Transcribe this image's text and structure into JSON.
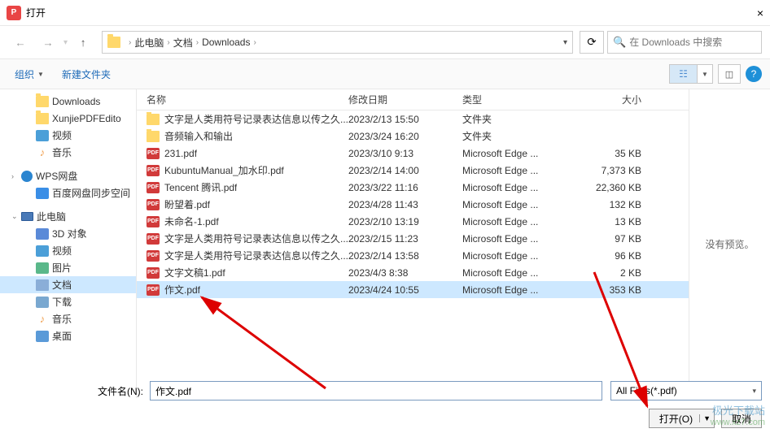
{
  "window": {
    "title": "打开",
    "close": "×"
  },
  "nav": {
    "crumbs": [
      "此电脑",
      "文档",
      "Downloads"
    ],
    "refresh": "↻",
    "search_placeholder": "在 Downloads 中搜索"
  },
  "toolbar": {
    "organize": "组织",
    "new_folder": "新建文件夹",
    "help": "?"
  },
  "sidebar": {
    "items": [
      {
        "label": "Downloads",
        "icon": "folder",
        "indent": 32
      },
      {
        "label": "XunjiePDFEdito",
        "icon": "folder",
        "indent": 32
      },
      {
        "label": "视频",
        "icon": "video",
        "indent": 32
      },
      {
        "label": "音乐",
        "icon": "music",
        "indent": 32
      },
      {
        "label": "WPS网盘",
        "icon": "wps",
        "indent": 14,
        "exp": "›"
      },
      {
        "label": "百度网盘同步空间",
        "icon": "baidu",
        "indent": 32
      },
      {
        "label": "此电脑",
        "icon": "pc",
        "indent": 14,
        "exp": "⌄"
      },
      {
        "label": "3D 对象",
        "icon": "3d",
        "indent": 32
      },
      {
        "label": "视频",
        "icon": "video",
        "indent": 32
      },
      {
        "label": "图片",
        "icon": "pic",
        "indent": 32
      },
      {
        "label": "文档",
        "icon": "doc",
        "indent": 32,
        "selected": true
      },
      {
        "label": "下载",
        "icon": "down",
        "indent": 32
      },
      {
        "label": "音乐",
        "icon": "music",
        "indent": 32
      },
      {
        "label": "桌面",
        "icon": "desk",
        "indent": 32
      }
    ]
  },
  "files": {
    "headers": {
      "name": "名称",
      "date": "修改日期",
      "type": "类型",
      "size": "大小"
    },
    "rows": [
      {
        "icon": "folder",
        "name": "文字是人类用符号记录表达信息以传之久...",
        "date": "2023/2/13 15:50",
        "type": "文件夹",
        "size": ""
      },
      {
        "icon": "folder",
        "name": "音频输入和输出",
        "date": "2023/3/24 16:20",
        "type": "文件夹",
        "size": ""
      },
      {
        "icon": "pdf",
        "name": "231.pdf",
        "date": "2023/3/10 9:13",
        "type": "Microsoft Edge ...",
        "size": "35 KB"
      },
      {
        "icon": "pdf",
        "name": "KubuntuManual_加水印.pdf",
        "date": "2023/2/14 14:00",
        "type": "Microsoft Edge ...",
        "size": "7,373 KB"
      },
      {
        "icon": "pdf",
        "name": "Tencent 腾讯.pdf",
        "date": "2023/3/22 11:16",
        "type": "Microsoft Edge ...",
        "size": "22,360 KB"
      },
      {
        "icon": "pdf",
        "name": "盼望着.pdf",
        "date": "2023/4/28 11:43",
        "type": "Microsoft Edge ...",
        "size": "132 KB"
      },
      {
        "icon": "pdf",
        "name": "未命名-1.pdf",
        "date": "2023/2/10 13:19",
        "type": "Microsoft Edge ...",
        "size": "13 KB"
      },
      {
        "icon": "pdf",
        "name": "文字是人类用符号记录表达信息以传之久...",
        "date": "2023/2/15 11:23",
        "type": "Microsoft Edge ...",
        "size": "97 KB"
      },
      {
        "icon": "pdf",
        "name": "文字是人类用符号记录表达信息以传之久...",
        "date": "2023/2/14 13:58",
        "type": "Microsoft Edge ...",
        "size": "96 KB"
      },
      {
        "icon": "pdf",
        "name": "文字文稿1.pdf",
        "date": "2023/4/3 8:38",
        "type": "Microsoft Edge ...",
        "size": "2 KB"
      },
      {
        "icon": "pdf",
        "name": "作文.pdf",
        "date": "2023/4/24 10:55",
        "type": "Microsoft Edge ...",
        "size": "353 KB",
        "selected": true
      }
    ]
  },
  "preview": {
    "empty": "没有预览。"
  },
  "filename": {
    "label": "文件名(N):",
    "value": "作文.pdf",
    "filter": "All Files(*.pdf)"
  },
  "buttons": {
    "open": "打开(O)",
    "cancel": "取消"
  },
  "watermark": {
    "line1": "极光下载站",
    "line2": "www.xz7.com"
  }
}
